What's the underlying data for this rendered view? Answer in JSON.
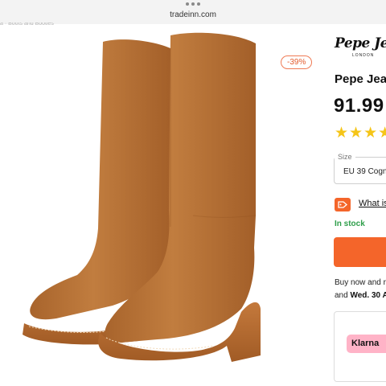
{
  "browser": {
    "url": "tradeinn.com",
    "scroll_text": "a · Boots and Booties"
  },
  "product": {
    "discount_badge": "-39%",
    "brand": {
      "name": "Pepe Jeans",
      "sub": "LONDON"
    },
    "title": "Pepe Jea",
    "price": "91.99",
    "rating": {
      "stars_shown": 4
    },
    "size": {
      "label": "Size",
      "value": "EU 39 Cogn"
    },
    "promo_link": "What is",
    "stock": "In stock",
    "delivery": {
      "line1": "Buy now and r",
      "line2_prefix": "and",
      "date": "Wed. 30 A"
    },
    "payment": {
      "provider": "Klarna"
    }
  },
  "colors": {
    "accent_orange": "#f4652a",
    "stock_green": "#2e9e4a",
    "star_yellow": "#f5c518",
    "klarna_pink": "#ffb3c7",
    "boot_suede": "#b87437"
  }
}
